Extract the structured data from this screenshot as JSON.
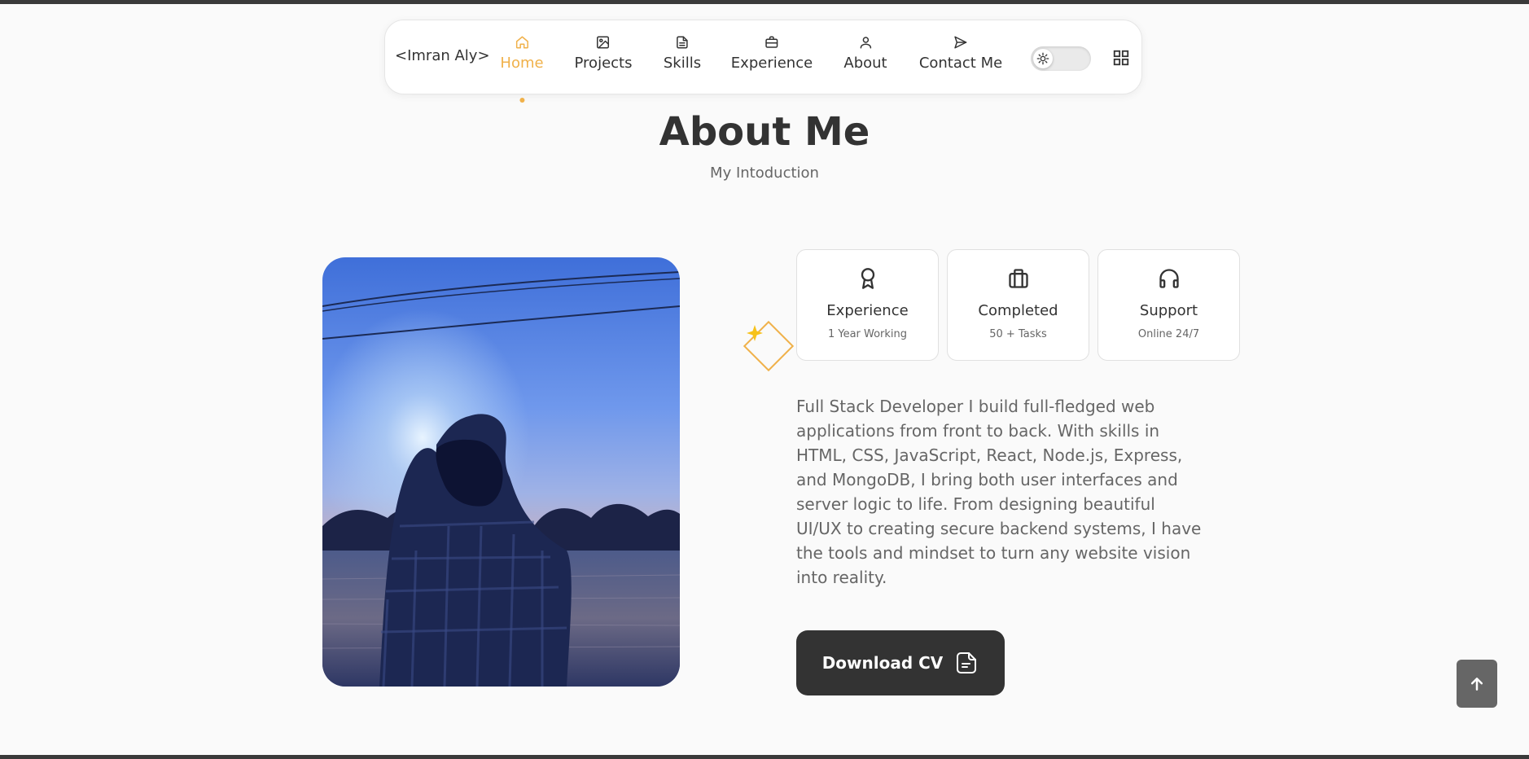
{
  "nav": {
    "brand": "<Imran Aly>",
    "items": [
      {
        "label": "Home",
        "icon": "home-icon",
        "active": true
      },
      {
        "label": "Projects",
        "icon": "image-icon",
        "active": false
      },
      {
        "label": "Skills",
        "icon": "document-icon",
        "active": false
      },
      {
        "label": "Experience",
        "icon": "briefcase-icon",
        "active": false
      },
      {
        "label": "About",
        "icon": "user-icon",
        "active": false
      },
      {
        "label": "Contact Me",
        "icon": "send-icon",
        "active": false
      }
    ],
    "theme_toggle_icon": "sun-icon",
    "menu_icon": "grid-icon"
  },
  "about": {
    "title": "About Me",
    "subtitle": "My Intoduction",
    "cards": [
      {
        "title": "Experience",
        "subtitle": "1 Year Working",
        "icon": "award-icon"
      },
      {
        "title": "Completed",
        "subtitle": "50 + Tasks",
        "icon": "briefcase-icon"
      },
      {
        "title": "Support",
        "subtitle": "Online 24/7",
        "icon": "headphones-icon"
      }
    ],
    "description": "Full Stack Developer I build full-fledged web applications from front to back. With skills in HTML, CSS, JavaScript, React, Node.js, Express, and MongoDB, I bring both user interfaces and server logic to life. From designing beautiful UI/UX to creating secure backend systems, I have the tools and mindset to turn any website vision into reality.",
    "download_label": "Download CV",
    "download_icon": "file-icon"
  },
  "colors": {
    "accent": "#f0b14a",
    "text": "#333333",
    "muted": "#666666",
    "background": "#fafafa"
  },
  "scroll_top_icon": "arrow-up-icon"
}
